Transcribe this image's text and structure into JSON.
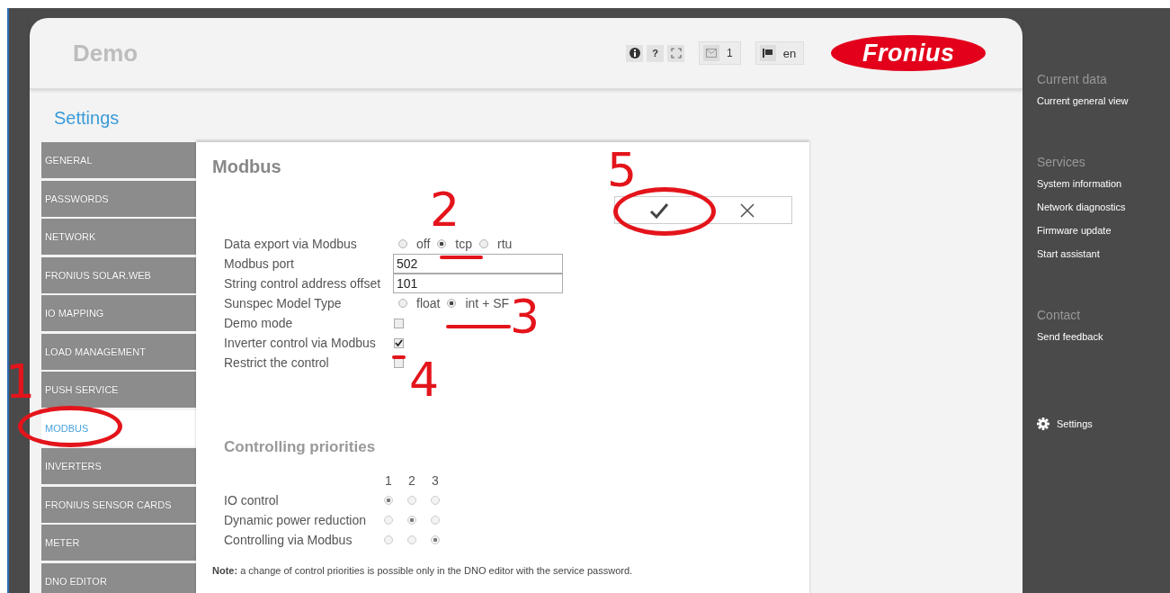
{
  "header": {
    "title": "Demo",
    "toolbar": [
      {
        "kind": "info"
      },
      {
        "kind": "help",
        "label": "?"
      },
      {
        "kind": "fullscreen"
      }
    ],
    "messages": {
      "count": "1"
    },
    "language": {
      "label": "en"
    },
    "logo": "Fronius"
  },
  "page_title": "Settings",
  "menu": [
    {
      "label": "GENERAL",
      "selected": false
    },
    {
      "label": "PASSWORDS",
      "selected": false
    },
    {
      "label": "NETWORK",
      "selected": false
    },
    {
      "label": "FRONIUS SOLAR.WEB",
      "selected": false
    },
    {
      "label": "IO MAPPING",
      "selected": false
    },
    {
      "label": "LOAD MANAGEMENT",
      "selected": false
    },
    {
      "label": "PUSH SERVICE",
      "selected": false
    },
    {
      "label": "MODBUS",
      "selected": true
    },
    {
      "label": "INVERTERS",
      "selected": false
    },
    {
      "label": "FRONIUS SENSOR CARDS",
      "selected": false
    },
    {
      "label": "METER",
      "selected": false
    },
    {
      "label": "DNO EDITOR",
      "selected": false
    }
  ],
  "panel": {
    "title": "Modbus",
    "buttons": [
      {
        "kind": "confirm"
      },
      {
        "kind": "cancel"
      }
    ],
    "fields": [
      {
        "kind": "radio",
        "label": "Data export via Modbus",
        "options": [
          {
            "label": "off",
            "selected": false
          },
          {
            "label": "tcp",
            "selected": true
          },
          {
            "label": "rtu",
            "selected": false
          }
        ]
      },
      {
        "kind": "input",
        "label": "Modbus port",
        "value": "502"
      },
      {
        "kind": "input",
        "label": "String control address offset",
        "value": "101"
      },
      {
        "kind": "radio",
        "label": "Sunspec Model Type",
        "options": [
          {
            "label": "float",
            "selected": false
          },
          {
            "label": "int + SF",
            "selected": true
          }
        ]
      },
      {
        "kind": "checkbox",
        "label": "Demo mode",
        "checked": false
      },
      {
        "kind": "checkbox",
        "label": "Inverter control via Modbus",
        "checked": true
      },
      {
        "kind": "checkbox",
        "label": "Restrict the control",
        "checked": false
      }
    ],
    "priorities": {
      "title": "Controlling priorities",
      "columns": [
        "1",
        "2",
        "3"
      ],
      "rows": [
        {
          "label": "IO control",
          "options": [
            {
              "selected": true
            },
            {
              "selected": false
            },
            {
              "selected": false
            }
          ]
        },
        {
          "label": "Dynamic power reduction",
          "options": [
            {
              "selected": false
            },
            {
              "selected": true
            },
            {
              "selected": false
            }
          ]
        },
        {
          "label": "Controlling via Modbus",
          "options": [
            {
              "selected": false
            },
            {
              "selected": false
            },
            {
              "selected": true
            }
          ]
        }
      ]
    },
    "note": "**Note:** a change of control priorities is possible only in the DNO editor with the service password."
  },
  "sidebar": {
    "sections": [
      {
        "heading": "Current data",
        "links": [
          "Current general view"
        ]
      },
      {
        "heading": "Services",
        "links": [
          "System information",
          "Network diagnostics",
          "Firmware update",
          "Start assistant"
        ]
      },
      {
        "heading": "Contact",
        "links": [
          "Send feedback"
        ]
      }
    ],
    "settings_link": "Settings"
  },
  "annotations": [
    {
      "label": "1"
    },
    {
      "label": "2"
    },
    {
      "label": "3"
    },
    {
      "label": "4"
    },
    {
      "label": "5"
    }
  ]
}
